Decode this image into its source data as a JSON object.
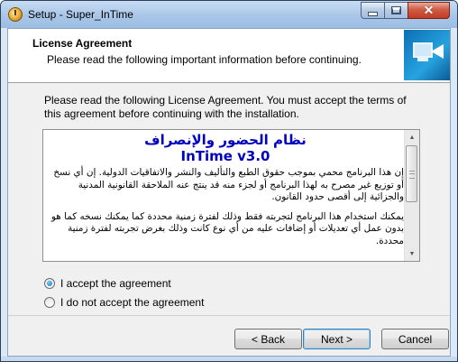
{
  "window": {
    "title": "Setup - Super_InTime",
    "controls": {
      "minimize": "minimize",
      "maximize": "maximize",
      "close": "✕"
    }
  },
  "header": {
    "title": "License Agreement",
    "subtitle": "Please read the following important information before continuing."
  },
  "intro_text": "Please read the following License Agreement. You must accept the terms of this agreement before continuing with the installation.",
  "license": {
    "heading": "نظام الحضور والإنصراف",
    "version": "InTime v3.0",
    "paragraph1": "إن هذا البرنامج محمي بموجب حقوق الطبع والتأليف والنشر والاتفاقيات الدولية. إن أي نسخ أو توزيع غير مصرح به لهذا البرنامج أو لجزء منه قد ينتج عنه الملاحقة القانونية المدنية والجزائية إلى أقصى حدود القانون.",
    "paragraph2": "يمكنك استخدام هذا البرنامج لتجربته فقط وذلك لفترة زمنية محددة كما يمكنك نسخه كما هو بدون عمل أي تعديلات أو إضافات عليه من أي نوع كانت وذلك بغرض تجربته لفترة زمنية محددة."
  },
  "options": {
    "accept_label": "I accept the agreement",
    "decline_label": "I do not accept the agreement",
    "selected": "accept"
  },
  "buttons": {
    "back": "< Back",
    "next": "Next >",
    "cancel": "Cancel"
  },
  "colors": {
    "license_heading": "#0000c0",
    "titlebar": "#a9c6e8",
    "close_button": "#c23b22"
  }
}
